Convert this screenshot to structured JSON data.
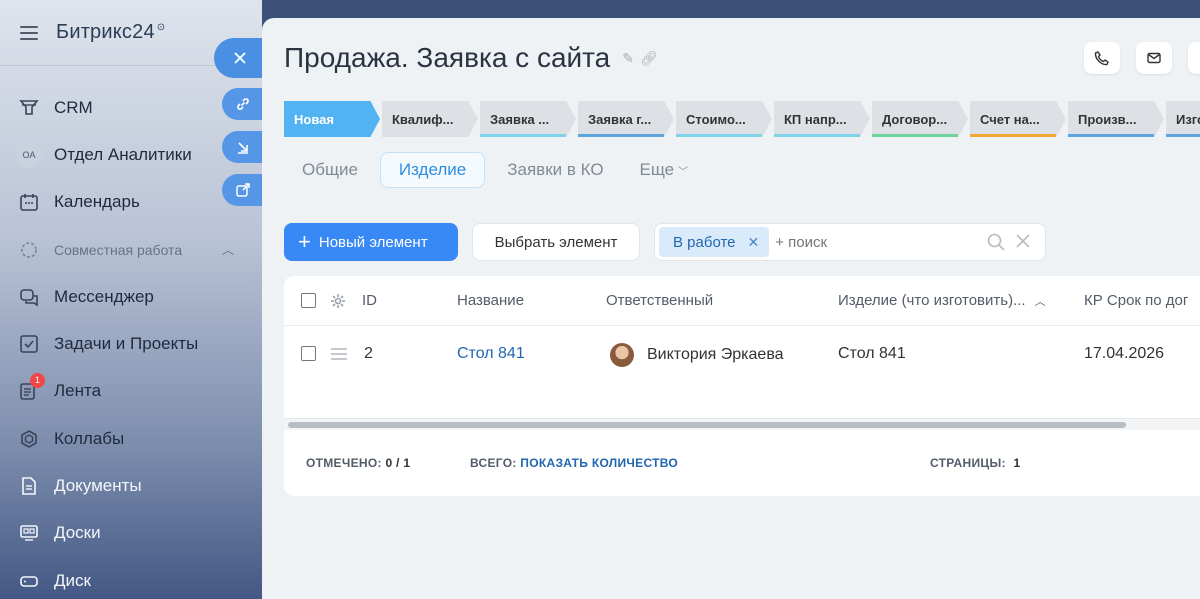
{
  "sidebar": {
    "logo": "Битрикс24",
    "logo_mark": "⊙",
    "items": [
      {
        "label": "CRM",
        "icon": "crm-icon"
      },
      {
        "label": "Отдел Аналитики",
        "avatar": "OA"
      },
      {
        "label": "Календарь",
        "icon": "calendar-icon"
      },
      {
        "label": "Совместная работа",
        "icon": "collab-section-icon",
        "section": true
      },
      {
        "label": "Мессенджер",
        "icon": "messenger-icon"
      },
      {
        "label": "Задачи и Проекты",
        "icon": "tasks-icon"
      },
      {
        "label": "Лента",
        "icon": "feed-icon",
        "badge": "1"
      },
      {
        "label": "Коллабы",
        "icon": "collabs-icon"
      },
      {
        "label": "Документы",
        "icon": "documents-icon"
      },
      {
        "label": "Доски",
        "icon": "boards-icon"
      },
      {
        "label": "Диск",
        "icon": "disk-icon"
      }
    ]
  },
  "page": {
    "title": "Продажа. Заявка с сайта"
  },
  "stages": [
    {
      "label": "Новая",
      "color": "#52b3f3",
      "active": true
    },
    {
      "label": "Квалиф...",
      "color": "#dde1e6"
    },
    {
      "label": "Заявка ...",
      "color": "#7fd3e8"
    },
    {
      "label": "Заявка г...",
      "color": "#5ba6e0"
    },
    {
      "label": "Стоимо...",
      "color": "#7fd3e8"
    },
    {
      "label": "КП напр...",
      "color": "#7fd3e8"
    },
    {
      "label": "Договор...",
      "color": "#6bd49a"
    },
    {
      "label": "Счет на...",
      "color": "#f0a830"
    },
    {
      "label": "Произв...",
      "color": "#5ba6e0"
    },
    {
      "label": "Изго...",
      "color": "#5ba6e0"
    }
  ],
  "tabs": [
    {
      "label": "Общие"
    },
    {
      "label": "Изделие",
      "active": true
    },
    {
      "label": "Заявки в КО"
    },
    {
      "label": "Еще"
    }
  ],
  "toolbar": {
    "new_label": "Новый элемент",
    "select_label": "Выбрать элемент",
    "filter_chip": "В работе",
    "search_placeholder": "+ поиск"
  },
  "grid": {
    "columns": [
      "ID",
      "Название",
      "Ответственный",
      "Изделие (что изготовить)...",
      "КР Срок по дог"
    ],
    "rows": [
      {
        "id": "2",
        "name": "Стол 841",
        "responsible": "Виктория Эркаева",
        "product": "Стол 841",
        "deadline": "17.04.2026"
      }
    ],
    "footer": {
      "checked_label": "ОТМЕЧЕНО:",
      "checked_value": "0 / 1",
      "total_label": "ВСЕГО:",
      "total_link": "ПОКАЗАТЬ КОЛИЧЕСТВО",
      "pages_label": "СТРАНИЦЫ:",
      "pages_value": "1"
    }
  }
}
